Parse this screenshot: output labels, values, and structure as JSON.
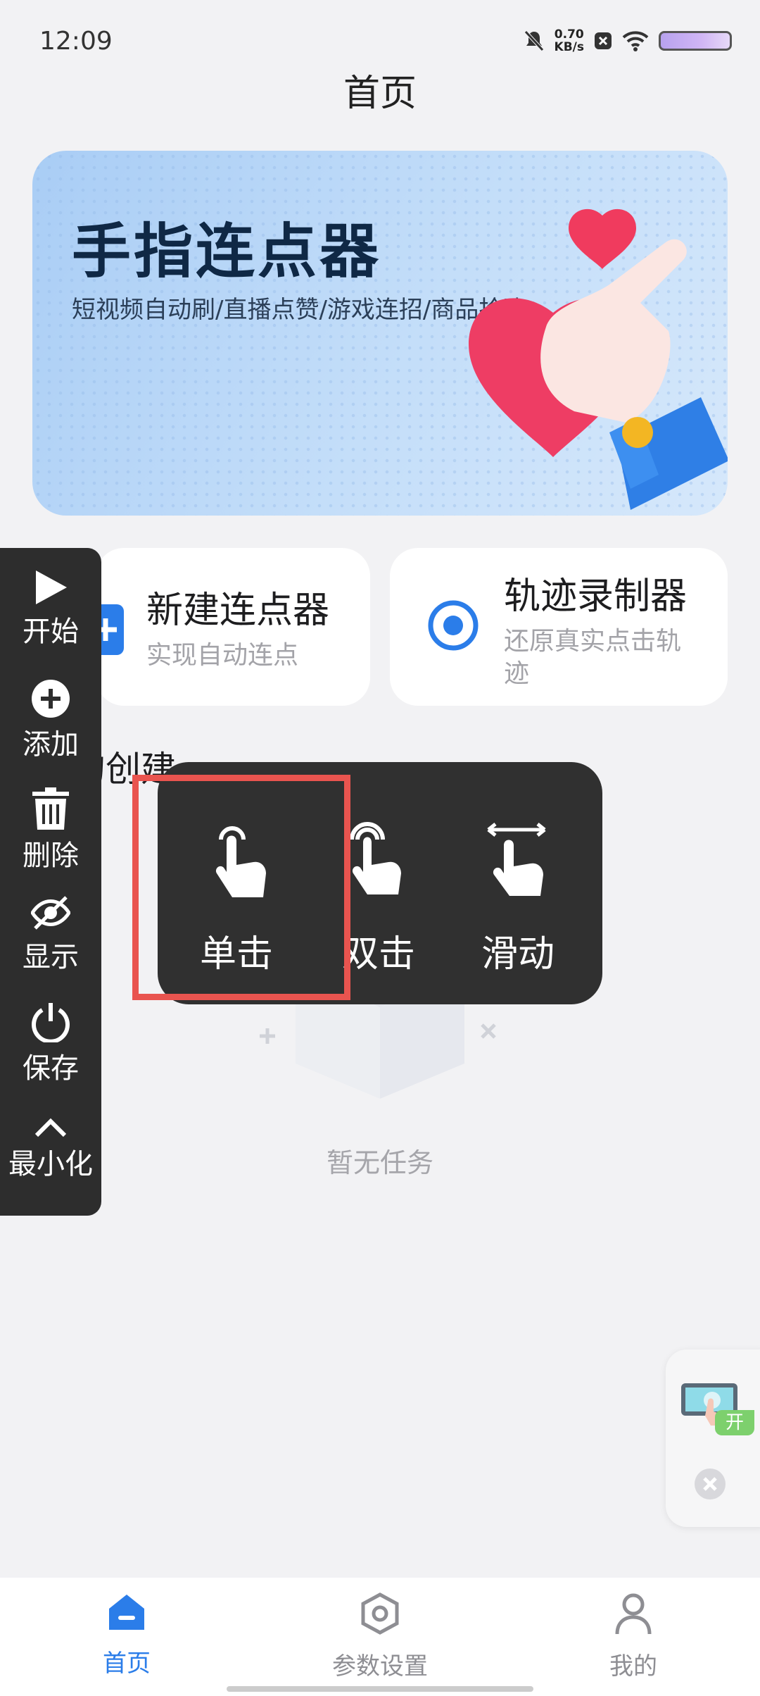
{
  "status_bar": {
    "time": "12:09",
    "speed_value": "0.70",
    "speed_unit": "KB/s"
  },
  "header": {
    "title": "首页"
  },
  "banner": {
    "title": "手指连点器",
    "subtitle": "短视频自动刷/直播点赞/游戏连招/商品抢购"
  },
  "cards": [
    {
      "title": "新建连点器",
      "subtitle": "实现自动连点"
    },
    {
      "title": "轨迹录制器",
      "subtitle_line1": "还原真实点击轨",
      "subtitle_line2": "迹"
    }
  ],
  "section": {
    "title": "我的创建",
    "empty_text": "暂无任务"
  },
  "float_panel": {
    "items": [
      {
        "label": "开始",
        "icon": "play-icon"
      },
      {
        "label": "添加",
        "icon": "plus-circle-icon"
      },
      {
        "label": "删除",
        "icon": "trash-icon"
      },
      {
        "label": "显示",
        "icon": "eye-off-icon"
      },
      {
        "label": "保存",
        "icon": "power-icon"
      },
      {
        "label": "最小化",
        "icon": "chevron-up-icon"
      }
    ]
  },
  "gesture_popup": {
    "items": [
      {
        "label": "单击",
        "icon": "tap-icon"
      },
      {
        "label": "双击",
        "icon": "double-tap-icon"
      },
      {
        "label": "滑动",
        "icon": "swipe-icon"
      }
    ]
  },
  "right_widget": {
    "badge": "开"
  },
  "bottom_nav": {
    "items": [
      {
        "label": "首页",
        "icon": "home-icon",
        "active": true
      },
      {
        "label": "参数设置",
        "icon": "settings-hex-icon",
        "active": false
      },
      {
        "label": "我的",
        "icon": "person-icon",
        "active": false
      }
    ]
  },
  "colors": {
    "accent": "#2b7de9",
    "highlight": "#e9544f",
    "panel_bg": "#2d2d2d"
  }
}
